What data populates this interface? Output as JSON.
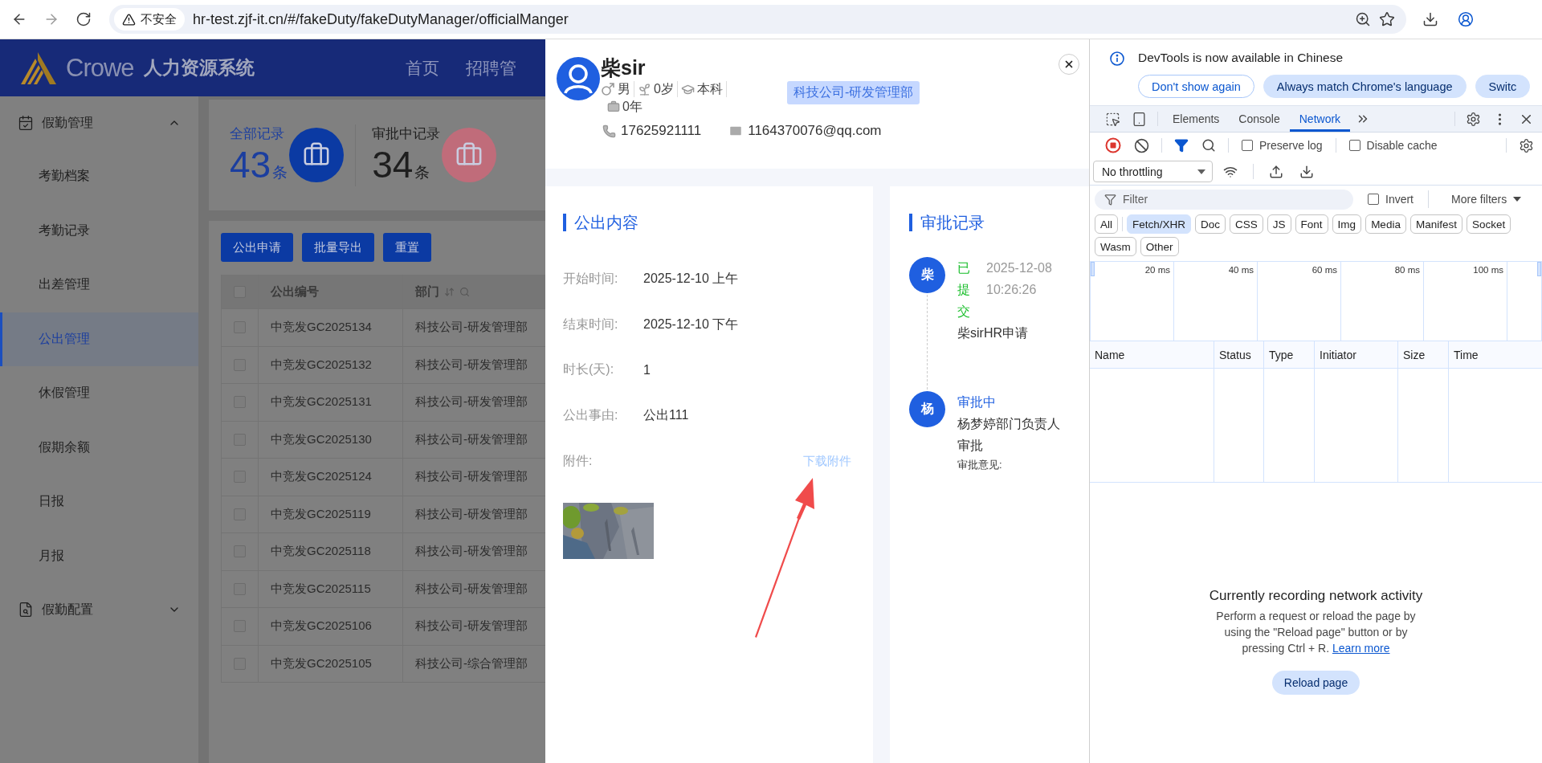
{
  "browser": {
    "security_label": "不安全",
    "url": "hr-test.zjf-it.cn/#/fakeDuty/fakeDutyManager/officialManger"
  },
  "app": {
    "logo_text": "Crowe",
    "system_name": "人力资源系统",
    "nav": [
      "首页",
      "招聘管"
    ]
  },
  "sidebar": [
    {
      "label": "假勤管理",
      "kind": "calendar",
      "expanded": true,
      "children": [
        {
          "label": "考勤档案",
          "selected": false
        },
        {
          "label": "考勤记录",
          "selected": false
        },
        {
          "label": "出差管理",
          "selected": false
        },
        {
          "label": "公出管理",
          "selected": true
        },
        {
          "label": "休假管理",
          "selected": false
        },
        {
          "label": "假期余额",
          "selected": false
        },
        {
          "label": "日报",
          "selected": false
        },
        {
          "label": "月报",
          "selected": false
        }
      ]
    },
    {
      "label": "假勤配置",
      "kind": "config",
      "expanded": false
    }
  ],
  "stats": [
    {
      "label": "全部记录",
      "count": "43",
      "unit": "条",
      "selected": true,
      "color": "#0b3aa3"
    },
    {
      "label": "审批中记录",
      "count": "34",
      "unit": "条",
      "selected": false,
      "color": "#c06c7a"
    }
  ],
  "actions": [
    "公出申请",
    "批量导出",
    "重置"
  ],
  "table": {
    "all_checked": false,
    "columns": [
      {
        "label": "公出编号",
        "sortable": false,
        "filterable": false
      },
      {
        "label": "部门",
        "sortable": true,
        "filterable": true
      }
    ],
    "rows": [
      {
        "checked": false,
        "cells": [
          "中竞发GC2025134",
          "科技公司-研发管理部"
        ]
      },
      {
        "checked": false,
        "cells": [
          "中竞发GC2025132",
          "科技公司-研发管理部"
        ]
      },
      {
        "checked": false,
        "cells": [
          "中竞发GC2025131",
          "科技公司-研发管理部"
        ]
      },
      {
        "checked": false,
        "cells": [
          "中竞发GC2025130",
          "科技公司-研发管理部"
        ]
      },
      {
        "checked": false,
        "cells": [
          "中竞发GC2025124",
          "科技公司-研发管理部"
        ]
      },
      {
        "checked": false,
        "cells": [
          "中竞发GC2025119",
          "科技公司-研发管理部"
        ]
      },
      {
        "checked": false,
        "cells": [
          "中竞发GC2025118",
          "科技公司-研发管理部"
        ]
      },
      {
        "checked": false,
        "cells": [
          "中竞发GC2025115",
          "科技公司-研发管理部"
        ]
      },
      {
        "checked": false,
        "cells": [
          "中竞发GC2025106",
          "科技公司-研发管理部"
        ]
      },
      {
        "checked": false,
        "cells": [
          "中竞发GC2025105",
          "科技公司-综合管理部"
        ]
      }
    ]
  },
  "drawer": {
    "person": {
      "name": "柴sir",
      "gender": "男",
      "age": "0岁",
      "education": "本科",
      "work_years": "0年",
      "department": "科技公司-研发管理部",
      "phone": "17625921111",
      "email": "1164370076@qq.com"
    },
    "content": {
      "title": "公出内容",
      "fields": [
        {
          "label": "开始时间:",
          "value": "2025-12-10 上午"
        },
        {
          "label": "结束时间:",
          "value": "2025-12-10 下午"
        },
        {
          "label": "时长(天):",
          "value": "1"
        },
        {
          "label": "公出事由:",
          "value": "公出111"
        }
      ],
      "attachment": {
        "label": "附件:",
        "action": "下载附件"
      }
    },
    "approval": {
      "title": "审批记录",
      "steps": [
        {
          "avatar": "柴",
          "status": "已提交",
          "color": "#19be2b",
          "time": "2025-12-08 10:26:26",
          "text": "柴sirHR申请"
        },
        {
          "avatar": "杨",
          "status": "审批中",
          "color": "#1f5fe0",
          "text": "杨梦婷部门负责人审批",
          "comment_label": "审批意见:"
        }
      ]
    }
  },
  "devtools": {
    "banner": {
      "message": "DevTools is now available in Chinese",
      "buttons": [
        {
          "label": "Don't show again",
          "kind": "outline"
        },
        {
          "label": "Always match Chrome's language",
          "kind": "filled"
        },
        {
          "label": "Switc",
          "kind": "filled"
        }
      ]
    },
    "tabs": [
      {
        "label": "Elements",
        "selected": false
      },
      {
        "label": "Console",
        "selected": false
      },
      {
        "label": "Network",
        "selected": true
      }
    ],
    "toolbar": {
      "recording": true,
      "filter_active": true,
      "options": [
        {
          "label": "Preserve log",
          "checked": false
        },
        {
          "label": "Disable cache",
          "checked": false
        }
      ],
      "throttling": "No throttling"
    },
    "filter": {
      "placeholder": "Filter",
      "invert": {
        "label": "Invert",
        "checked": false
      },
      "more_filters": "More filters"
    },
    "types": [
      {
        "label": "All",
        "selected": false
      },
      {
        "label": "Fetch/XHR",
        "selected": true
      },
      {
        "label": "Doc",
        "selected": false
      },
      {
        "label": "CSS",
        "selected": false
      },
      {
        "label": "JS",
        "selected": false
      },
      {
        "label": "Font",
        "selected": false
      },
      {
        "label": "Img",
        "selected": false
      },
      {
        "label": "Media",
        "selected": false
      },
      {
        "label": "Manifest",
        "selected": false
      },
      {
        "label": "Socket",
        "selected": false
      },
      {
        "label": "Wasm",
        "selected": false
      },
      {
        "label": "Other",
        "selected": false
      }
    ],
    "overview_ticks": [
      "20 ms",
      "40 ms",
      "60 ms",
      "80 ms",
      "100 ms"
    ],
    "columns": [
      "Name",
      "Status",
      "Type",
      "Initiator",
      "Size",
      "Time"
    ],
    "empty": {
      "title": "Currently recording network activity",
      "text": "Perform a request or reload the page by using the \"Reload page\" button or by pressing Ctrl + R.",
      "link": "Learn more",
      "button": "Reload page"
    }
  }
}
